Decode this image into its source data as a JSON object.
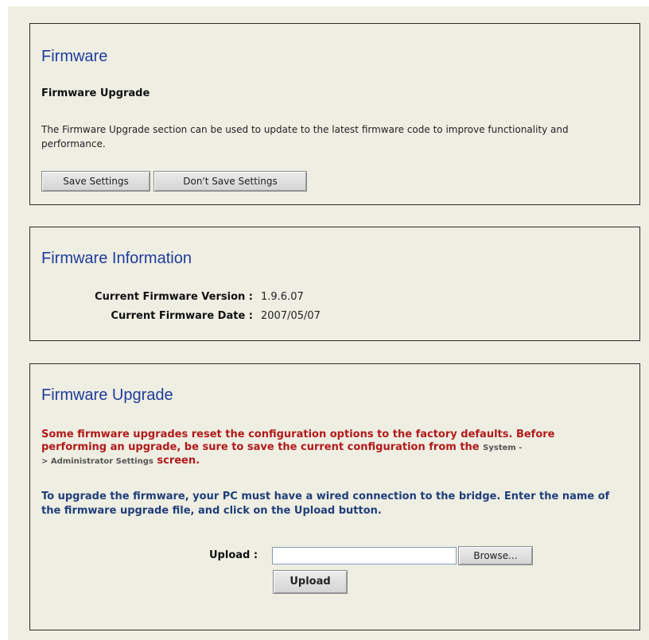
{
  "firmware_panel": {
    "title": "Firmware",
    "subtitle": "Firmware Upgrade",
    "description": "The Firmware Upgrade section can be used to update to the latest firmware code to improve functionality and performance.",
    "save_button": "Save Settings",
    "dont_save_button": "Don't Save Settings"
  },
  "info_panel": {
    "title": "Firmware Information",
    "version_label": "Current Firmware Version :",
    "version_value": "1.9.6.07",
    "date_label": "Current Firmware Date :",
    "date_value": "2007/05/07"
  },
  "upgrade_panel": {
    "title": "Firmware Upgrade",
    "warning_part1": "Some firmware upgrades reset the configuration options to the factory defaults. Before performing an upgrade, be sure to save the current configuration from the ",
    "warning_link1": "System -",
    "warning_link2": "> Administrator Settings",
    "warning_part2": " screen.",
    "instructions": "To upgrade the firmware, your PC must have a wired connection to the bridge. Enter the name of the firmware upgrade file, and click on the Upload button.",
    "upload_label": "Upload :",
    "upload_value": "",
    "browse_button": "Browse...",
    "upload_button": "Upload"
  }
}
